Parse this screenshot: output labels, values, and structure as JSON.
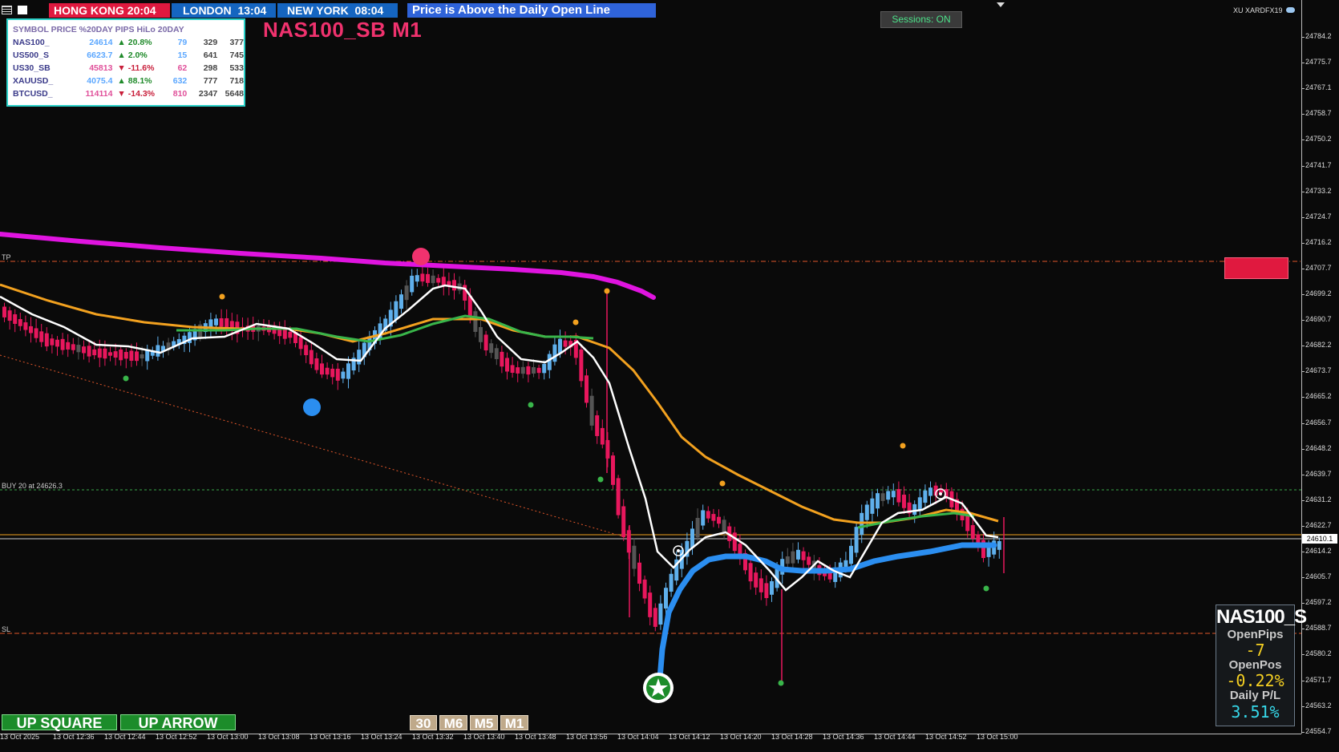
{
  "topbar": {
    "sessions": [
      {
        "name": "HONG KONG",
        "time": "20:04",
        "bg": "#e0193f"
      },
      {
        "name": "LONDON",
        "time": "13:04",
        "bg": "#1565c0"
      },
      {
        "name": "NEW YORK",
        "time": "08:04",
        "bg": "#1565c0"
      }
    ],
    "status_message": "Price is Above the Daily Open Line",
    "status_bg": "#2f63d9"
  },
  "chart": {
    "title": "NAS100_SB M1",
    "sessions_button": "Sessions: ON",
    "broker": "XU XARDFX19",
    "tp_label": "TP",
    "buy_label": "BUY 20 at 24626.3",
    "sl_label": "SL",
    "current_price": "24610.1",
    "price_ticks": [
      "24784.2",
      "24775.7",
      "24767.1",
      "24758.7",
      "24750.2",
      "24741.7",
      "24733.2",
      "24724.7",
      "24716.2",
      "24707.7",
      "24699.2",
      "24690.7",
      "24682.2",
      "24673.7",
      "24665.2",
      "24656.7",
      "24648.2",
      "24639.7",
      "24631.2",
      "24622.7",
      "24614.2",
      "24605.7",
      "24597.2",
      "24588.7",
      "24580.2",
      "24571.7",
      "24563.2",
      "24554.7"
    ],
    "time_ticks": [
      "13 Oct 2025",
      "13 Oct 12:36",
      "13 Oct 12:44",
      "13 Oct 12:52",
      "13 Oct 13:00",
      "13 Oct 13:08",
      "13 Oct 13:16",
      "13 Oct 13:24",
      "13 Oct 13:32",
      "13 Oct 13:40",
      "13 Oct 13:48",
      "13 Oct 13:56",
      "13 Oct 14:04",
      "13 Oct 14:12",
      "13 Oct 14:20",
      "13 Oct 14:28",
      "13 Oct 14:36",
      "13 Oct 14:44",
      "13 Oct 14:52",
      "13 Oct 15:00"
    ]
  },
  "watchlist": {
    "header": [
      "SYMBOL",
      "PRICE",
      "%20DAY",
      "PIPS",
      "HiLo",
      "20DAY"
    ],
    "rows": [
      {
        "symbol": "NAS100_",
        "price": "24614",
        "dir": "▲",
        "pct": "20.8%",
        "pips": "79",
        "hilo": "329",
        "day20": "377",
        "up": true
      },
      {
        "symbol": "US500_S",
        "price": "6623.7",
        "dir": "▲",
        "pct": "2.0%",
        "pips": "15",
        "hilo": "641",
        "day20": "745",
        "up": true
      },
      {
        "symbol": "US30_SB",
        "price": "45813",
        "dir": "▼",
        "pct": "-11.6%",
        "pips": "62",
        "hilo": "298",
        "day20": "533",
        "up": false
      },
      {
        "symbol": "XAUUSD_",
        "price": "4075.4",
        "dir": "▲",
        "pct": "88.1%",
        "pips": "632",
        "hilo": "777",
        "day20": "718",
        "up": true
      },
      {
        "symbol": "BTCUSD_",
        "price": "114114",
        "dir": "▼",
        "pct": "-14.3%",
        "pips": "810",
        "hilo": "2347",
        "day20": "5648",
        "up": false
      }
    ]
  },
  "buttons": {
    "up_square": "UP SQUARE",
    "up_arrow": "UP ARROW",
    "tf1": "30",
    "tf2": "M6",
    "tf3": "M5",
    "tf4": "M1"
  },
  "panel": {
    "symbol": "NAS100_S",
    "open_pips_label": "OpenPips",
    "open_pips": "-7",
    "open_pos_label": "OpenPos",
    "open_pos": "-0.22%",
    "daily_pl_label": "Daily P/L",
    "daily_pl": "3.51%"
  },
  "colors": {
    "bull": "#5fb0ec",
    "bear": "#e8175d",
    "neutral": "#555555",
    "ma_orange": "#f2a11f",
    "ma_green": "#39b54a",
    "ma_white": "#ffffff",
    "ma_blue": "#2b8ef0",
    "ma_magenta": "#e014e0"
  }
}
